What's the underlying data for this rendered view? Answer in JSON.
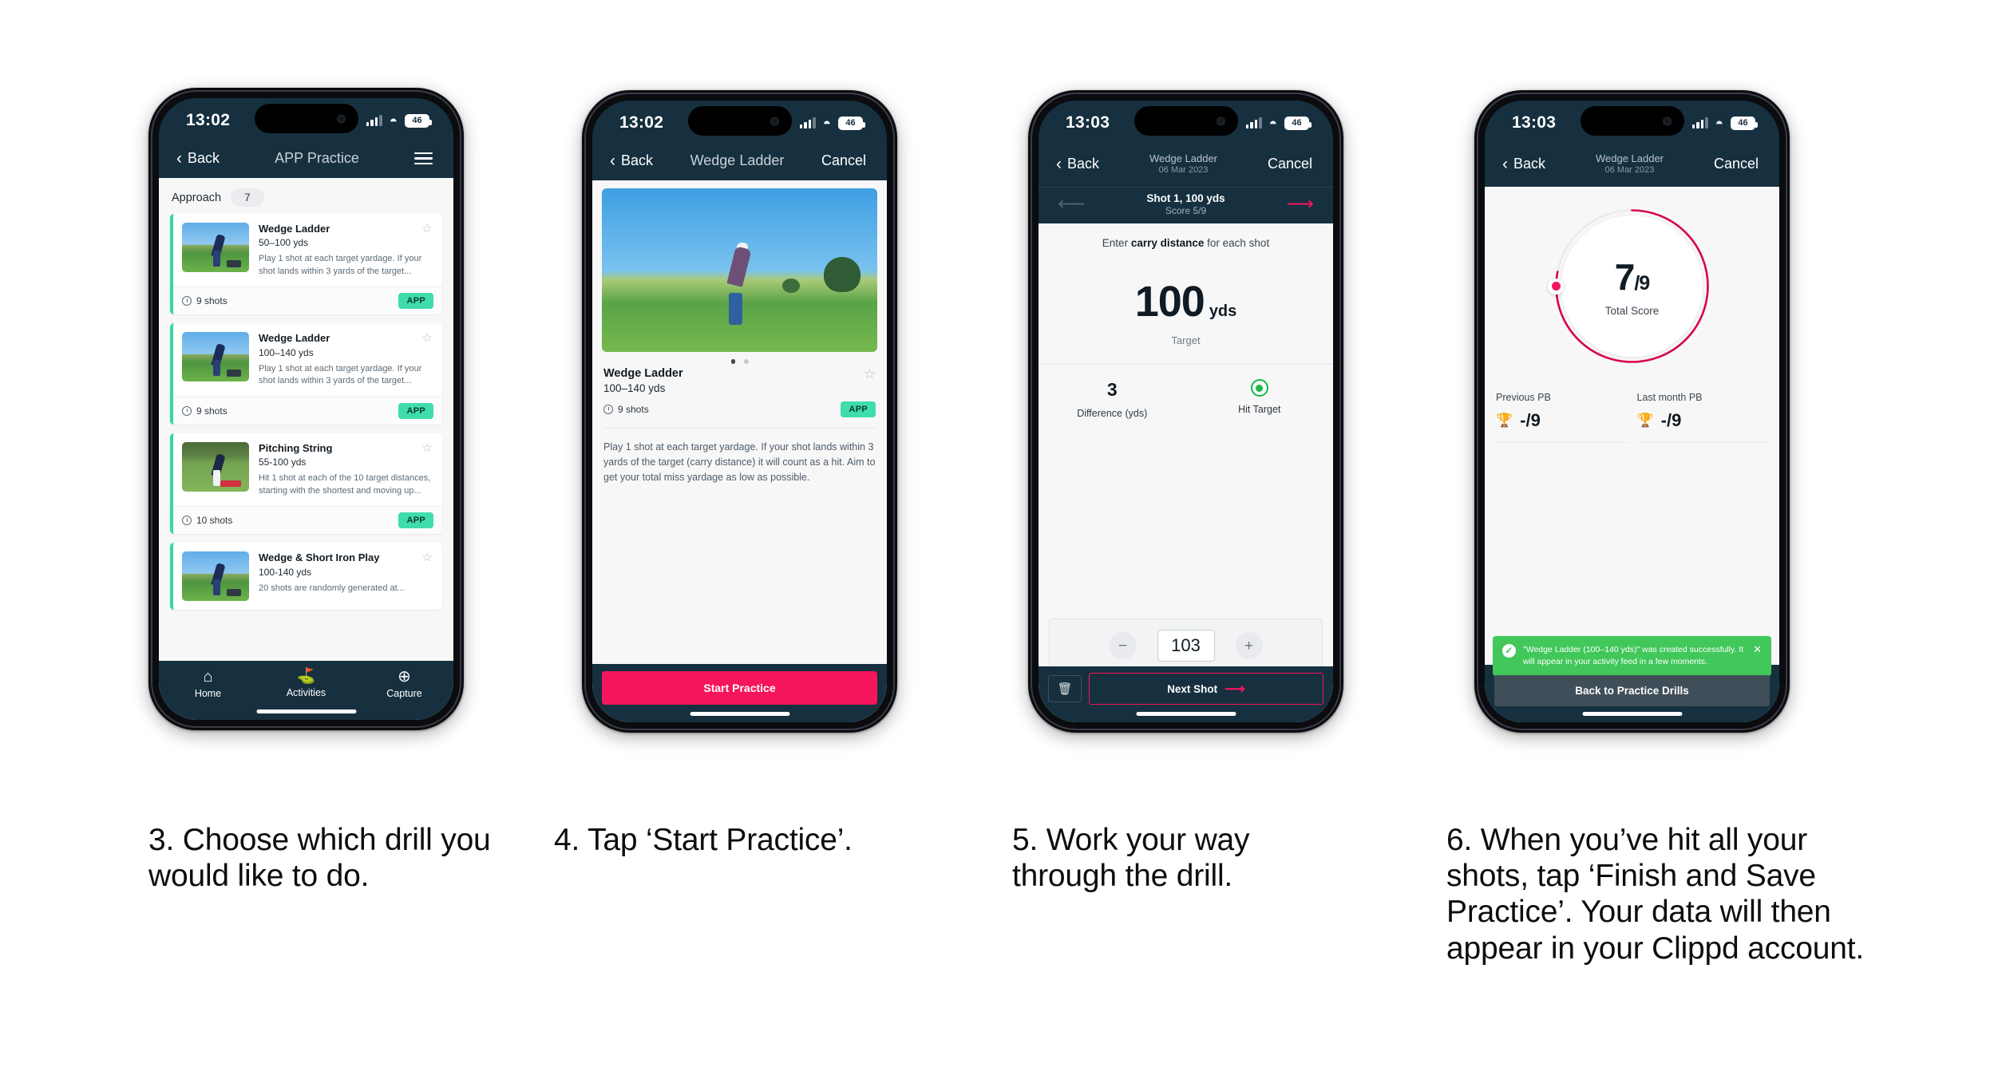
{
  "accent": {
    "pink": "#F5155C",
    "teal": "#3FDCAC",
    "green": "#41C75A",
    "navy": "#16303F"
  },
  "phones": [
    {
      "status": {
        "time": "13:02",
        "battery": "46"
      },
      "nav": {
        "back": "Back",
        "title": "APP Practice",
        "menu_icon": "hamburger-icon"
      },
      "section": {
        "label": "Approach",
        "count": "7"
      },
      "cards": [
        {
          "title": "Wedge Ladder",
          "range": "50–100 yds",
          "desc": "Play 1 shot at each target yardage. If your shot lands within 3 yards of the target...",
          "shots": "9 shots",
          "tag": "APP"
        },
        {
          "title": "Wedge Ladder",
          "range": "100–140 yds",
          "desc": "Play 1 shot at each target yardage. If your shot lands within 3 yards of the target...",
          "shots": "9 shots",
          "tag": "APP"
        },
        {
          "title": "Pitching String",
          "range": "55-100 yds",
          "desc": "Hit 1 shot at each of the 10 target distances, starting with the shortest and moving up...",
          "shots": "10 shots",
          "tag": "APP"
        },
        {
          "title": "Wedge & Short Iron Play",
          "range": "100-140 yds",
          "desc": "20 shots are randomly generated at...",
          "shots": "",
          "tag": ""
        }
      ],
      "tabs": [
        {
          "label": "Home",
          "icon": "home-icon"
        },
        {
          "label": "Activities",
          "icon": "golf-flag-icon"
        },
        {
          "label": "Capture",
          "icon": "plus-circle-icon"
        }
      ]
    },
    {
      "status": {
        "time": "13:02",
        "battery": "46"
      },
      "nav": {
        "back": "Back",
        "title": "Wedge Ladder",
        "cancel": "Cancel"
      },
      "detail": {
        "title": "Wedge Ladder",
        "range": "100–140 yds",
        "shots": "9 shots",
        "tag": "APP",
        "description": "Play 1 shot at each target yardage. If your shot lands within 3 yards of the target (carry distance) it will count as a hit. Aim to get your total miss yardage as low as possible."
      },
      "cta": "Start Practice"
    },
    {
      "status": {
        "time": "13:03",
        "battery": "46"
      },
      "nav": {
        "back": "Back",
        "title": "Wedge Ladder",
        "subtitle": "06 Mar 2023",
        "cancel": "Cancel"
      },
      "shotbar": {
        "title": "Shot 1, 100 yds",
        "score": "Score 5/9",
        "prev_icon": "arrow-left-icon",
        "next_icon": "arrow-right-icon"
      },
      "entry": {
        "prompt_pre": "Enter ",
        "prompt_bold": "carry distance",
        "prompt_post": " for each shot",
        "target_value": "100",
        "target_unit": "yds",
        "target_label": "Target",
        "difference_value": "3",
        "difference_label": "Difference (yds)",
        "hit_label": "Hit Target",
        "hit_icon": "bullseye-icon",
        "stepper_value": "103",
        "minus": "−",
        "plus": "+"
      },
      "footer": {
        "delete_icon": "trash-icon",
        "next": "Next Shot",
        "next_arrow": "⟶"
      }
    },
    {
      "status": {
        "time": "13:03",
        "battery": "46"
      },
      "nav": {
        "back": "Back",
        "title": "Wedge Ladder",
        "subtitle": "06 Mar 2023",
        "cancel": "Cancel"
      },
      "result": {
        "score_num": "7",
        "score_den": "/9",
        "score_label": "Total Score",
        "progress_pct": 78
      },
      "pbs": [
        {
          "label": "Previous PB",
          "value": "-/9",
          "icon": "trophy-icon"
        },
        {
          "label": "Last month PB",
          "value": "-/9",
          "icon": "trophy-icon"
        }
      ],
      "toast": {
        "message": "\"Wedge Ladder (100–140 yds)\" was created successfully. It will appear in your activity feed in a few moments.",
        "close_icon": "close-icon",
        "check_icon": "check-icon"
      },
      "cta": "Back to Practice Drills"
    }
  ],
  "captions": [
    "3. Choose which drill you would like to do.",
    "4. Tap ‘Start Practice’.",
    "5. Work your way through the drill.",
    "6. When you’ve hit all your shots, tap ‘Finish and Save Practice’. Your data will then appear in your Clippd account."
  ]
}
